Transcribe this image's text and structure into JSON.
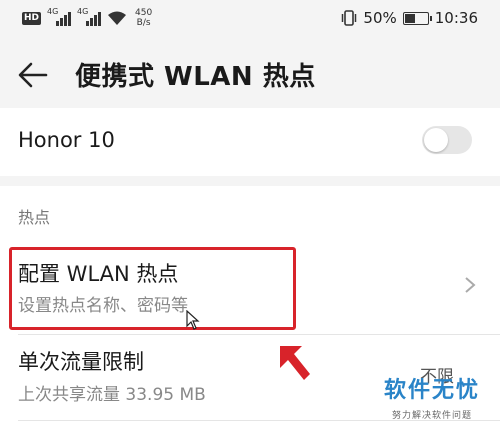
{
  "status_bar": {
    "hd_badge": "HD",
    "network_type_1": "4G",
    "network_type_2": "4G",
    "speed_value": "450",
    "speed_unit": "B/s",
    "battery_percent": "50%",
    "battery_level": 0.5,
    "time": "10:36"
  },
  "header": {
    "title": "便携式 WLAN 热点"
  },
  "device": {
    "name": "Honor 10",
    "hotspot_enabled": false
  },
  "section": {
    "label": "热点"
  },
  "items": [
    {
      "title": "配置 WLAN 热点",
      "subtitle": "设置热点名称、密码等"
    },
    {
      "title": "单次流量限制",
      "subtitle": "上次共享流量 33.95 MB",
      "value": "不限"
    }
  ],
  "watermark": {
    "title": "软件无忧",
    "subtitle": "努力解决软件问题"
  },
  "colors": {
    "highlight": "#d8232a",
    "watermark": "#2a84c8",
    "background": "#f4f4f4"
  }
}
